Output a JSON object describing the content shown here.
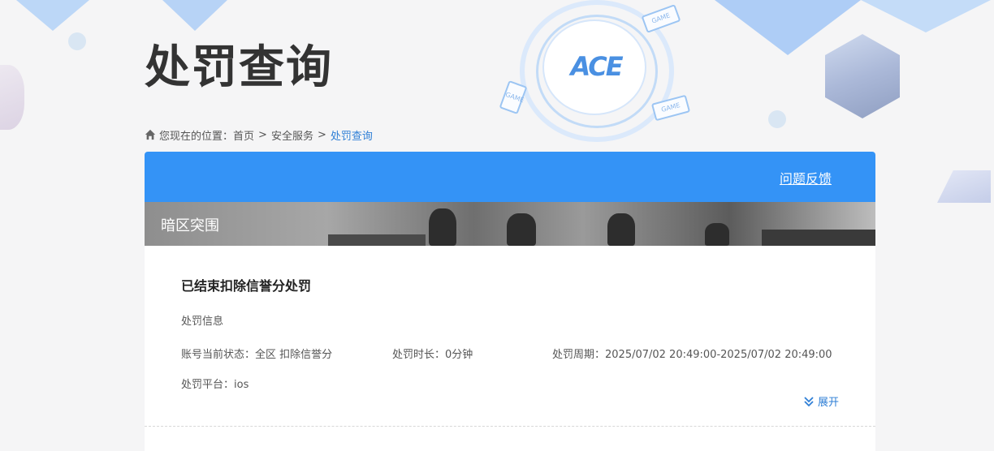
{
  "header": {
    "title": "处罚查询",
    "logo_text": "ACE",
    "game_tag_text": "GAME"
  },
  "breadcrumb": {
    "prefix": "您现在的位置：",
    "items": [
      "首页",
      "安全服务",
      "处罚查询"
    ],
    "separator": ">"
  },
  "panel": {
    "feedback_label": "问题反馈",
    "game_name": "暗区突围"
  },
  "record": {
    "title": "已结束扣除信誉分处罚",
    "section_label": "处罚信息",
    "status": "账号当前状态：全区 扣除信誉分",
    "duration": "处罚时长：0分钟",
    "period": "处罚周期：2025/07/02 20:49:00-2025/07/02 20:49:00",
    "platform": "处罚平台：ios",
    "expand_label": "展开"
  },
  "colors": {
    "accent": "#3493f6",
    "link": "#2f7fd6",
    "title": "#333333"
  }
}
